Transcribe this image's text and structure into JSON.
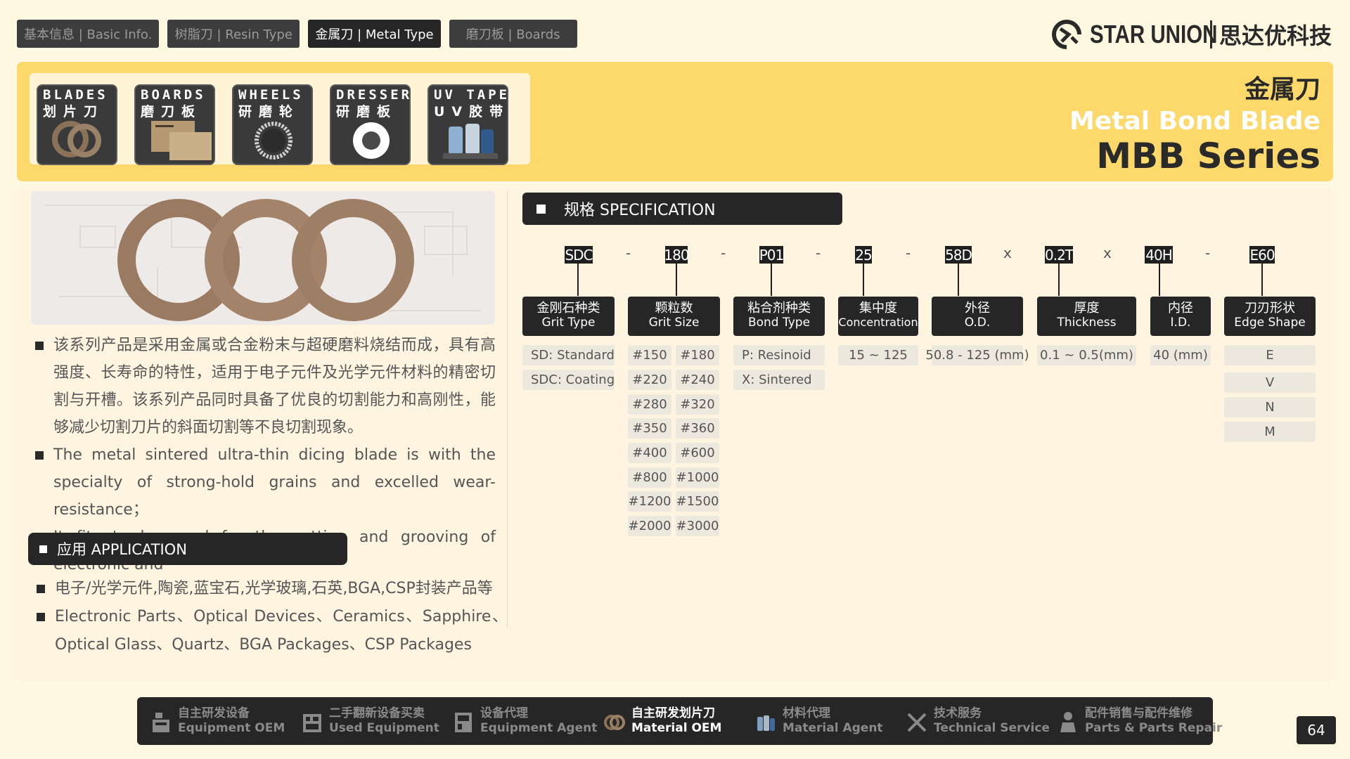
{
  "tabs": [
    {
      "label": "基本信息 | Basic Info.",
      "active": false
    },
    {
      "label": "树脂刀 | Resin Type",
      "active": false
    },
    {
      "label": "金属刀 | Metal Type",
      "active": true
    },
    {
      "label": "磨刀板 | Boards",
      "active": false
    }
  ],
  "logo": {
    "en": "STAR UNION",
    "cn": "思达优科技"
  },
  "categories": [
    {
      "en": "BLADES",
      "cn": "划片刀"
    },
    {
      "en": "BOARDS",
      "cn": "磨刀板"
    },
    {
      "en": "WHEELS",
      "cn": "研磨轮"
    },
    {
      "en": "DRESSER",
      "cn": "研磨板"
    },
    {
      "en": "UV TAPES",
      "cn": "UV胶带"
    }
  ],
  "title": {
    "cn": "金属刀",
    "en": "Metal Bond Blade",
    "series": "MBB Series"
  },
  "description": [
    "该系列产品是采用金属或合金粉末与超硬磨料烧结而成，具有高强度、长寿命的特性，适用于电子元件及光学元件材料的精密切割与开槽。该系列产品同时具备了优良的切割能力和高刚性，能够减少切割刀片的斜面切割等不良切割现象。",
    "The metal sintered ultra-thin dicing blade is with the specialty of strong-hold grains and excelled wear-resistance；",
    "It fits to be used for the cutting and grooving of electronic and"
  ],
  "application": {
    "heading": "应用 APPLICATION",
    "items": [
      "电子/光学元件,陶瓷,蓝宝石,光学玻璃,石英,BGA,CSP封装产品等",
      "Electronic Parts、Optical Devices、Ceramics、Sapphire、Optical Glass、Quartz、BGA Packages、CSP Packages"
    ]
  },
  "spec": {
    "heading": "规格 SPECIFICATION",
    "codes": [
      "SDC",
      "180",
      "P01",
      "25",
      "58D",
      "0.2T",
      "40H",
      "E60"
    ],
    "separators": [
      "-",
      "-",
      "-",
      "-",
      "x",
      "x",
      "-"
    ],
    "columns": [
      {
        "cn": "金刚石种类",
        "en": "Grit Type"
      },
      {
        "cn": "颗粒数",
        "en": "Grit Size"
      },
      {
        "cn": "粘合剂种类",
        "en": "Bond Type"
      },
      {
        "cn": "集中度",
        "en": "Concentration"
      },
      {
        "cn": "外径",
        "en": "O.D."
      },
      {
        "cn": "厚度",
        "en": "Thickness"
      },
      {
        "cn": "内径",
        "en": "I.D."
      },
      {
        "cn": "刀刃形状",
        "en": "Edge Shape"
      }
    ],
    "grit_type": [
      "SD: Standard",
      "SDC: Coating"
    ],
    "grit_size": [
      "#150",
      "#180",
      "#220",
      "#240",
      "#280",
      "#320",
      "#350",
      "#360",
      "#400",
      "#600",
      "#800",
      "#1000",
      "#1200",
      "#1500",
      "#2000",
      "#3000"
    ],
    "bond_type": [
      "P: Resinoid",
      "X: Sintered"
    ],
    "concentration": "15 ~ 125",
    "od": "50.8 - 125 (mm)",
    "thickness": "0.1 ~ 0.5(mm)",
    "id": "40 (mm)",
    "edge_shape": [
      "E",
      "V",
      "N",
      "M"
    ]
  },
  "nav": [
    {
      "cn": "自主研发设备",
      "en": "Equipment OEM",
      "icon": "equipment-icon",
      "active": false
    },
    {
      "cn": "二手翻新设备买卖",
      "en": "Used Equipment",
      "icon": "used-equipment-icon",
      "active": false
    },
    {
      "cn": "设备代理",
      "en": "Equipment Agent",
      "icon": "agent-icon",
      "active": false
    },
    {
      "cn": "自主研发划片刀",
      "en": "Material OEM",
      "icon": "blade-rings-icon",
      "active": true
    },
    {
      "cn": "材料代理",
      "en": "Material Agent",
      "icon": "material-icon",
      "active": false
    },
    {
      "cn": "技术服务",
      "en": "Technical Service",
      "icon": "tools-icon",
      "active": false
    },
    {
      "cn": "配件销售与配件维修",
      "en": "Parts & Parts Repair",
      "icon": "worker-icon",
      "active": false
    }
  ],
  "page_number": "64",
  "colors": {
    "accent": "#fdd86a",
    "dark": "#262626",
    "background": "#fff8e1"
  }
}
